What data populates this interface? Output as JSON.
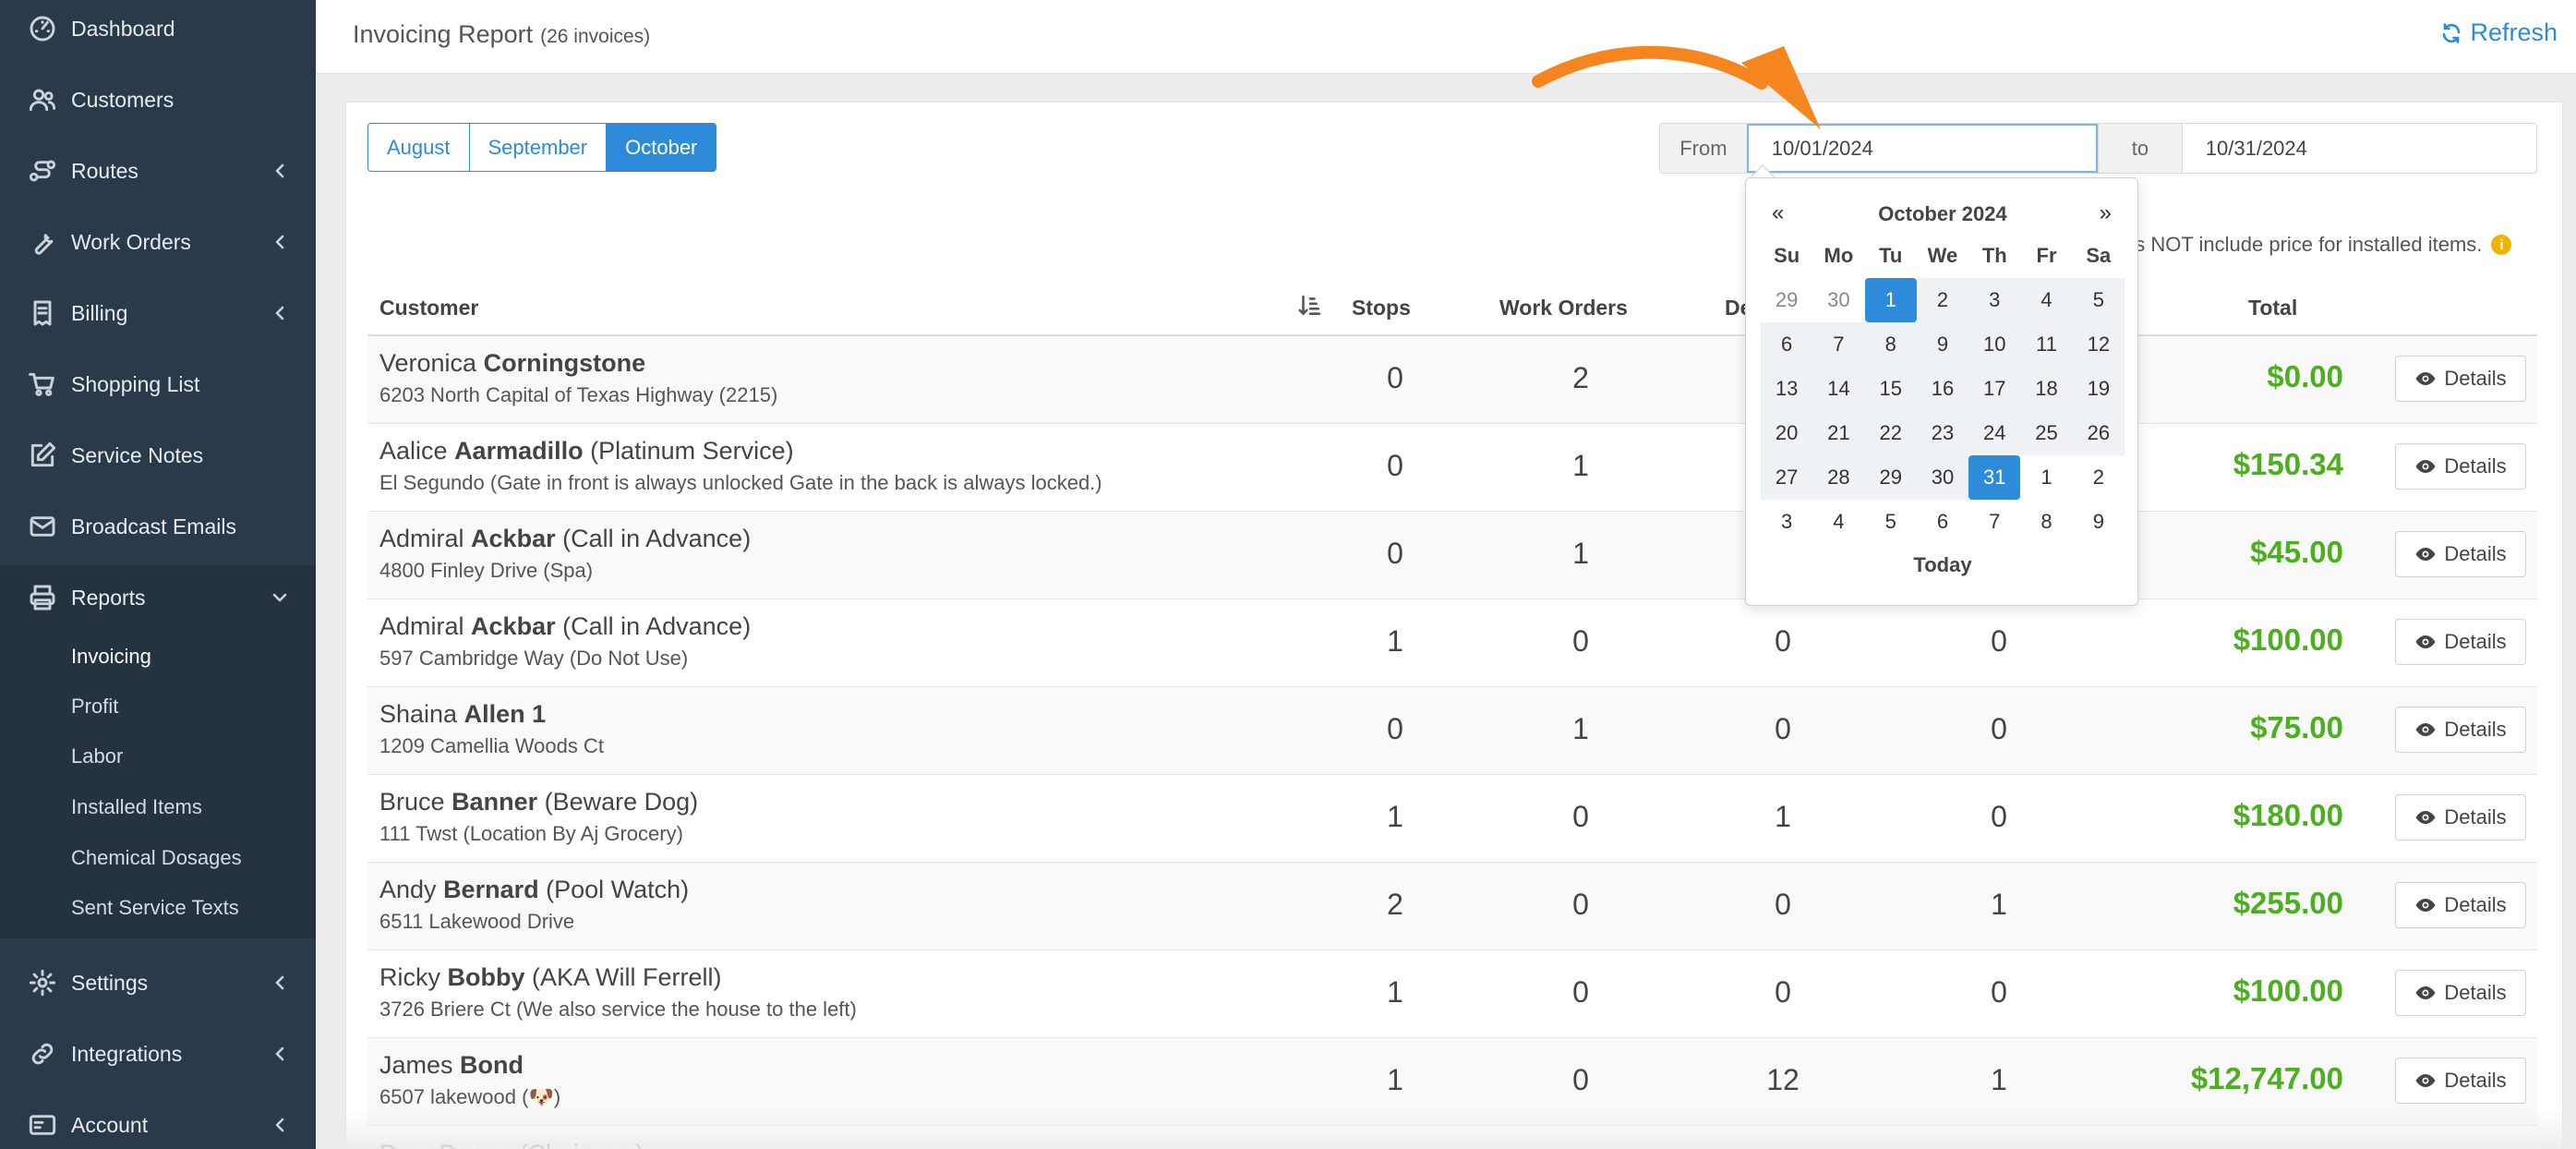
{
  "sidebar": {
    "items": [
      {
        "label": "Dashboard",
        "icon": "dashboard-icon"
      },
      {
        "label": "Customers",
        "icon": "users-icon"
      },
      {
        "label": "Routes",
        "icon": "route-icon"
      },
      {
        "label": "Work Orders",
        "icon": "wrench-icon"
      },
      {
        "label": "Billing",
        "icon": "invoice-icon"
      },
      {
        "label": "Shopping List",
        "icon": "cart-icon"
      },
      {
        "label": "Service Notes",
        "icon": "note-edit-icon"
      },
      {
        "label": "Broadcast Emails",
        "icon": "envelope-icon"
      },
      {
        "label": "Reports",
        "icon": "printer-icon"
      },
      {
        "label": "Settings",
        "icon": "gear-icon"
      },
      {
        "label": "Integrations",
        "icon": "link-icon"
      },
      {
        "label": "Account",
        "icon": "id-card-icon"
      }
    ],
    "reports_sub": [
      "Invoicing",
      "Profit",
      "Labor",
      "Installed Items",
      "Chemical Dosages",
      "Sent Service Texts"
    ]
  },
  "header": {
    "title": "Invoicing Report",
    "subtitle": "(26 invoices)",
    "refresh_label": "Refresh"
  },
  "filters": {
    "months": [
      "August",
      "September",
      "October"
    ],
    "active_month": "October",
    "from_label": "From",
    "to_label": "to",
    "from_value": "10/01/2024",
    "to_value": "10/31/2024"
  },
  "note": "es NOT include price for installed items.",
  "table": {
    "headers": {
      "customer": "Customer",
      "stops": "Stops",
      "work_orders": "Work Orders",
      "de": "De",
      "total": "Total"
    },
    "details_label": "Details",
    "rows": [
      {
        "first": "Veronica",
        "last": "Corningstone",
        "suffix": "",
        "address": "6203 North Capital of Texas Highway (2215)",
        "stops": "0",
        "work_orders": "2",
        "col3": "",
        "col4": "",
        "total": "$0.00"
      },
      {
        "first": "Aalice",
        "last": "Aarmadillo",
        "suffix": " (Platinum Service)",
        "address": "El Segundo (Gate in front is always unlocked Gate in the back is always locked.)",
        "stops": "0",
        "work_orders": "1",
        "col3": "",
        "col4": "",
        "total": "$150.34"
      },
      {
        "first": "Admiral",
        "last": "Ackbar",
        "suffix": " (Call in Advance)",
        "address": "4800 Finley Drive (Spa)",
        "stops": "0",
        "work_orders": "1",
        "col3": "",
        "col4": "",
        "total": "$45.00"
      },
      {
        "first": "Admiral",
        "last": "Ackbar",
        "suffix": " (Call in Advance)",
        "address": "597 Cambridge Way (Do Not Use)",
        "stops": "1",
        "work_orders": "0",
        "col3": "0",
        "col4": "0",
        "total": "$100.00"
      },
      {
        "first": "Shaina",
        "last": "Allen 1",
        "suffix": "",
        "address": "1209 Camellia Woods Ct",
        "stops": "0",
        "work_orders": "1",
        "col3": "0",
        "col4": "0",
        "total": "$75.00"
      },
      {
        "first": "Bruce",
        "last": "Banner",
        "suffix": " (Beware Dog)",
        "address": "111 Twst (Location By Aj Grocery)",
        "stops": "1",
        "work_orders": "0",
        "col3": "1",
        "col4": "0",
        "total": "$180.00"
      },
      {
        "first": "Andy",
        "last": "Bernard",
        "suffix": " (Pool Watch)",
        "address": "6511 Lakewood Drive",
        "stops": "2",
        "work_orders": "0",
        "col3": "0",
        "col4": "1",
        "total": "$255.00"
      },
      {
        "first": "Ricky",
        "last": "Bobby",
        "suffix": " (AKA Will Ferrell)",
        "address": "3726 Briere Ct (We also service the house to the left)",
        "stops": "1",
        "work_orders": "0",
        "col3": "0",
        "col4": "0",
        "total": "$100.00"
      },
      {
        "first": "James",
        "last": "Bond",
        "suffix": "",
        "address": "6507 lakewood (🐶)",
        "stops": "1",
        "work_orders": "0",
        "col3": "12",
        "col4": "1",
        "total": "$12,747.00"
      }
    ],
    "partial_row": "Dam Damm (Chairman)"
  },
  "datepicker": {
    "title": "October 2024",
    "prev": "«",
    "next": "»",
    "weekdays": [
      "Su",
      "Mo",
      "Tu",
      "We",
      "Th",
      "Fr",
      "Sa"
    ],
    "weeks": [
      [
        "29",
        "30",
        "1",
        "2",
        "3",
        "4",
        "5"
      ],
      [
        "6",
        "7",
        "8",
        "9",
        "10",
        "11",
        "12"
      ],
      [
        "13",
        "14",
        "15",
        "16",
        "17",
        "18",
        "19"
      ],
      [
        "20",
        "21",
        "22",
        "23",
        "24",
        "25",
        "26"
      ],
      [
        "27",
        "28",
        "29",
        "30",
        "31",
        "1",
        "2"
      ],
      [
        "3",
        "4",
        "5",
        "6",
        "7",
        "8",
        "9"
      ]
    ],
    "today_label": "Today"
  },
  "colors": {
    "sidebar_bg": "#2b3a4a",
    "accent": "#2e8bd9",
    "total_green": "#4caf1f",
    "arrow_orange": "#f5861f",
    "info_badge": "#f0b400"
  }
}
